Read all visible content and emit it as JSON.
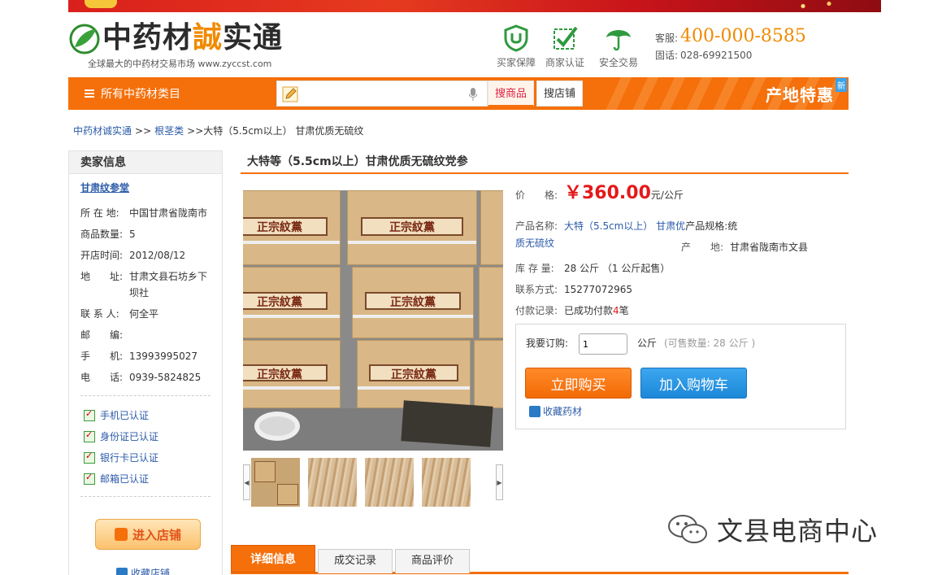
{
  "header": {
    "logo_name_parts": [
      "中药材",
      "誠",
      "实通"
    ],
    "logo_slogan": "全球最大的中药材交易市场 www.zyccst.com",
    "guarantees": [
      {
        "label": "买家保障",
        "icon": "shield-u-icon"
      },
      {
        "label": "商家认证",
        "icon": "checkbox-icon"
      },
      {
        "label": "安全交易",
        "icon": "umbrella-icon"
      }
    ],
    "hotline_label": "客服:",
    "hotline": "400-000-8585",
    "tel_label": "固话:",
    "tel": "028-69921500"
  },
  "nav": {
    "category_label": "所有中药材类目",
    "search_placeholder": "",
    "tab_goods": "搜商品",
    "tab_shop": "搜店铺",
    "promo_text": "产地特惠",
    "promo_badge": "新"
  },
  "breadcrumb": {
    "home": "中药材诚实通",
    "sep1": ">>",
    "cat": "根茎类",
    "sep2": ">>",
    "current": "大特（5.5cm以上） 甘肃优质无硫纹"
  },
  "seller": {
    "header": "卖家信息",
    "shop_name": "甘肃纹参堂",
    "location_label": "所 在 地:",
    "location": "中国甘肃省陇南市",
    "count_label": "商品数量:",
    "count": "5",
    "opened_label": "开店时间:",
    "opened": "2012/08/12",
    "address_label": "地　　址:",
    "address": "甘肃文县石坊乡下坝社",
    "contact_label": "联 系 人:",
    "contact": "何全平",
    "postcode_label": "邮　　编:",
    "postcode": "",
    "mobile_label": "手　　机:",
    "mobile": "13993995027",
    "phone_label": "电　　话:",
    "phone": "0939-5824825",
    "certs": [
      "手机已认证",
      "身份证已认证",
      "银行卡已认证",
      "邮箱已认证"
    ],
    "enter_shop": "进入店铺",
    "fav_shop": "收藏店铺"
  },
  "product": {
    "title": "大特等（5.5cm以上）甘肃优质无硫纹党参",
    "box_label": "正宗紋黨",
    "price_label": "价　　格:",
    "price": "￥360.00",
    "price_unit": "元/公斤",
    "name_label": "产品名称:",
    "name_line1": "大特（5.5cm以上） 甘肃优",
    "name_line2": "质无硫纹",
    "spec_label": "产品规格:",
    "spec": "统",
    "origin_label": "产　　地:",
    "origin": "甘肃省陇南市文县",
    "stock_label": "库 存 量:",
    "stock": "28 公斤 （1 公斤起售）",
    "contact_label": "联系方式:",
    "contact": "15277072965",
    "payment_label": "付款记录:",
    "payment_prefix": "已成功付款",
    "payment_count": "4",
    "payment_suffix": "笔"
  },
  "buy": {
    "qty_label": "我要订购:",
    "qty_value": "1",
    "unit": "公斤",
    "avail": "(可售数量: 28 公斤 )",
    "buy_now": "立即购买",
    "add_cart": "加入购物车",
    "fav_item": "收藏药材"
  },
  "tabs": [
    "详细信息",
    "成交记录",
    "商品评价"
  ],
  "watermark": "文县电商中心",
  "colors": {
    "brand_orange": "#f56f0a",
    "price_red": "#e4191a",
    "link_blue": "#2a5aa8",
    "cart_blue": "#1c88d8"
  }
}
